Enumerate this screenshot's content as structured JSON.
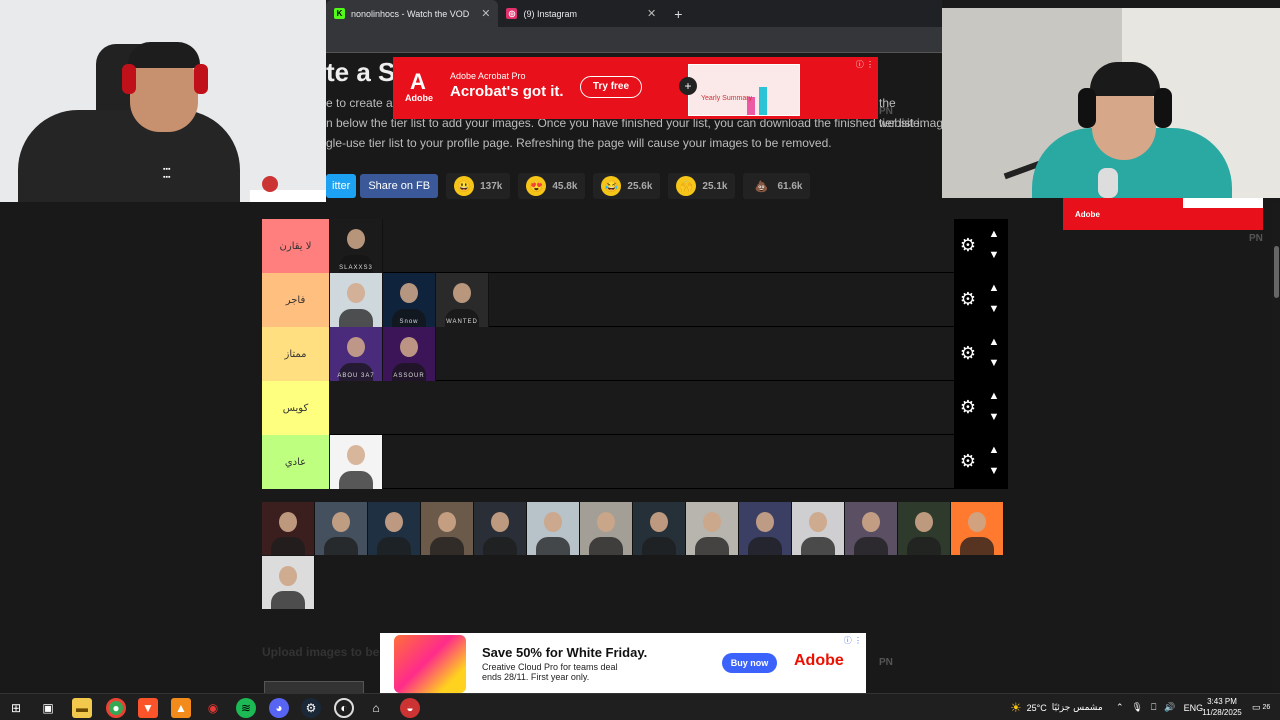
{
  "browser": {
    "tabs": [
      {
        "title": "nonolinhocs - Watch the VOD",
        "icon": "kick-icon",
        "color": "#53fc18"
      },
      {
        "title": "(9) Instagram",
        "icon": "instagram-icon",
        "color": "#e1306c"
      }
    ],
    "new_tab": "+",
    "close": "✕"
  },
  "page": {
    "heading": "te a S",
    "intro": [
      "e to create a s",
      "n below the tier list to add your images. Once you have finished your list, you can download the finished tier list image. It is",
      "gle-use tier list to your profile page. Refreshing the page will cause your images to be removed."
    ],
    "intro_tail": "the website.",
    "share_twitter": "itter",
    "share_fb": "Share on FB",
    "reactions": [
      {
        "icon": "grinning-emoji-icon",
        "glyph": "😃",
        "count": "137k"
      },
      {
        "icon": "heart-eyes-emoji-icon",
        "glyph": "😍",
        "count": "45.8k"
      },
      {
        "icon": "laughing-emoji-icon",
        "glyph": "😂",
        "count": "25.6k"
      },
      {
        "icon": "raised-hands-emoji-icon",
        "glyph": "🙌",
        "count": "25.1k"
      },
      {
        "icon": "poop-emoji-icon",
        "glyph": "💩",
        "count": "61.6k"
      }
    ],
    "upload_label": "Upload images to be"
  },
  "tiers": [
    {
      "label": "لا يقارن",
      "color": "#ff7f7f",
      "items": [
        {
          "color": "#1b1b1b",
          "tag": "SLAXXS3"
        }
      ]
    },
    {
      "label": "فاجر",
      "color": "#ffbf7f",
      "items": [
        {
          "color": "#cfd8dc",
          "tag": ""
        },
        {
          "color": "#10233d",
          "tag": "Snow"
        },
        {
          "color": "#2a2a2a",
          "tag": "WANTED"
        }
      ]
    },
    {
      "label": "ممتاز",
      "color": "#ffdf7f",
      "items": [
        {
          "color": "#4a2a7a",
          "tag": "ABOU 3A7"
        },
        {
          "color": "#3c1558",
          "tag": "ASSOUR"
        }
      ]
    },
    {
      "label": "كويس",
      "color": "#ffff7f",
      "items": []
    },
    {
      "label": "عادي",
      "color": "#bfff7f",
      "items": [
        {
          "color": "#f4f4f4",
          "tag": ""
        }
      ]
    }
  ],
  "pool": [
    [
      "#3b1e1e",
      "#44505e",
      "#1f3042",
      "#6b5a4a",
      "#2a2e36",
      "#b7c2c9",
      "#a39e96",
      "#263038",
      "#b8b5ae",
      "#3a3f63",
      "#cfcfd2",
      "#5a4f63",
      "#2e3a2c",
      "#ff7a2e"
    ],
    [
      "#dcdcdc"
    ]
  ],
  "ads": {
    "top": {
      "brand": "Adobe",
      "small": "Adobe Acrobat Pro",
      "headline": "Acrobat's got it.",
      "cta": "Try free",
      "shot_text": "Yearly Summary"
    },
    "bottom": {
      "headline": "Save 50% for White Friday.",
      "line1": "Creative Cloud Pro for teams deal",
      "line2": "ends 28/11. First year only.",
      "cta": "Buy now",
      "brand": "Adobe"
    },
    "right": {
      "brand": "Adobe"
    },
    "pn": "PN"
  },
  "taskbar": {
    "weather": "25°C",
    "weather_desc": "مشمس جزئيًا",
    "lang": "ENG",
    "time": "3:43 PM",
    "date": "11/28/2025",
    "notif": "26"
  }
}
